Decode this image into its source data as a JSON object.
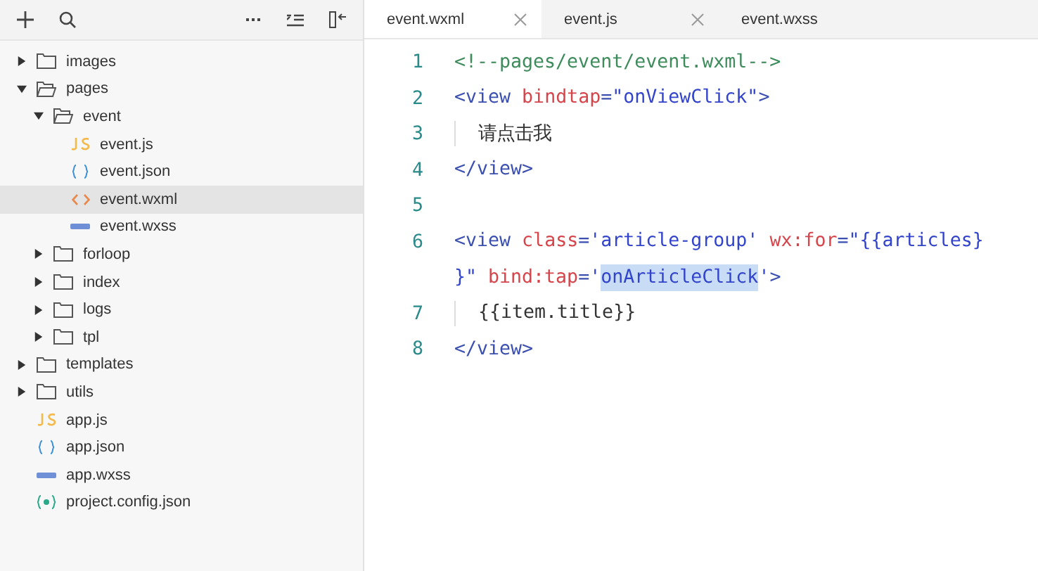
{
  "sidebar": {
    "toolbar": [
      {
        "kind": "add"
      },
      {
        "kind": "search"
      },
      {
        "kind": "more"
      },
      {
        "kind": "collapse"
      },
      {
        "kind": "split"
      }
    ],
    "tree": [
      {
        "label": "images",
        "kind": "folder",
        "expanded": false,
        "selected": false
      },
      {
        "label": "pages",
        "kind": "folder",
        "expanded": true,
        "selected": false,
        "children": [
          {
            "label": "event",
            "kind": "folder",
            "expanded": true,
            "selected": false,
            "children": [
              {
                "label": "event.js",
                "kind": "js",
                "selected": false
              },
              {
                "label": "event.json",
                "kind": "json",
                "selected": false
              },
              {
                "label": "event.wxml",
                "kind": "wxml",
                "selected": true
              },
              {
                "label": "event.wxss",
                "kind": "wxss",
                "selected": false
              }
            ]
          },
          {
            "label": "forloop",
            "kind": "folder",
            "expanded": false,
            "selected": false
          },
          {
            "label": "index",
            "kind": "folder",
            "expanded": false,
            "selected": false
          },
          {
            "label": "logs",
            "kind": "folder",
            "expanded": false,
            "selected": false
          },
          {
            "label": "tpl",
            "kind": "folder",
            "expanded": false,
            "selected": false
          }
        ]
      },
      {
        "label": "templates",
        "kind": "folder",
        "expanded": false,
        "selected": false
      },
      {
        "label": "utils",
        "kind": "folder",
        "expanded": false,
        "selected": false
      },
      {
        "label": "app.js",
        "kind": "js",
        "selected": false
      },
      {
        "label": "app.json",
        "kind": "json",
        "selected": false
      },
      {
        "label": "app.wxss",
        "kind": "wxss",
        "selected": false
      },
      {
        "label": "project.config.json",
        "kind": "config",
        "selected": false
      }
    ]
  },
  "tabs": [
    {
      "label": "event.wxml",
      "selected": true,
      "closable": true
    },
    {
      "label": "event.js",
      "selected": false,
      "closable": true
    },
    {
      "label": "event.wxss",
      "selected": false,
      "closable": false
    }
  ],
  "editor": {
    "lines": [
      {
        "number": "1",
        "tokens": [
          {
            "kind": "comment",
            "text": "<!--pages/event/event.wxml-->"
          }
        ]
      },
      {
        "number": "2",
        "tokens": [
          {
            "kind": "punct",
            "text": "<"
          },
          {
            "kind": "tag",
            "text": "view"
          },
          {
            "kind": "attr",
            "text": " bindtap"
          },
          {
            "kind": "punct",
            "text": "="
          },
          {
            "kind": "string",
            "text": "\"onViewClick\""
          },
          {
            "kind": "punct",
            "text": ">"
          }
        ]
      },
      {
        "number": "3",
        "indented": true,
        "tokens": [
          {
            "kind": "text",
            "text": "请点击我"
          }
        ]
      },
      {
        "number": "4",
        "tokens": [
          {
            "kind": "punct",
            "text": "</"
          },
          {
            "kind": "tag",
            "text": "view"
          },
          {
            "kind": "punct",
            "text": ">"
          }
        ]
      },
      {
        "number": "5"
      },
      {
        "number": "6",
        "tokens": [
          {
            "kind": "punct",
            "text": "<"
          },
          {
            "kind": "tag",
            "text": "view"
          },
          {
            "kind": "attr",
            "text": " class"
          },
          {
            "kind": "punct",
            "text": "="
          },
          {
            "kind": "string",
            "text": "'article-group'"
          },
          {
            "kind": "attr",
            "text": " wx:for"
          },
          {
            "kind": "punct",
            "text": "="
          },
          {
            "kind": "string",
            "text": "\"{{articles}"
          },
          {
            "kind": "string",
            "text": "}\""
          },
          {
            "kind": "attr",
            "text": " bind:tap"
          },
          {
            "kind": "punct",
            "text": "="
          },
          {
            "kind": "string",
            "text": "'"
          },
          {
            "kind": "selection",
            "text": "onArticleClick"
          },
          {
            "kind": "string",
            "text": "'"
          },
          {
            "kind": "punct",
            "text": ">"
          }
        ]
      },
      {
        "number": "7",
        "indented": true,
        "tokens": [
          {
            "kind": "text",
            "text": "{{item.title}}"
          }
        ]
      },
      {
        "number": "8",
        "tokens": [
          {
            "kind": "punct",
            "text": "</"
          },
          {
            "kind": "tag",
            "text": "view"
          },
          {
            "kind": "punct",
            "text": ">"
          }
        ]
      }
    ]
  }
}
